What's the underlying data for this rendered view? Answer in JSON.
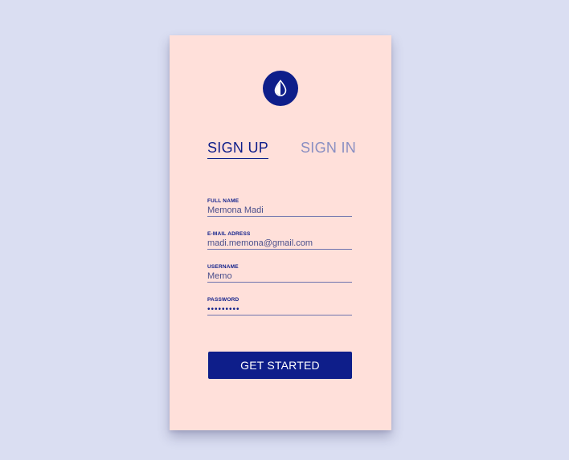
{
  "colors": {
    "background": "#DADEF2",
    "card": "#FFE0DA",
    "accent": "#0E1E8A",
    "inactive_tab": "#8A8FC2",
    "input_text": "#4A4F8C"
  },
  "logo": {
    "icon": "drop-icon"
  },
  "tabs": [
    {
      "label": "SIGN UP",
      "active": true
    },
    {
      "label": "SIGN IN",
      "active": false
    }
  ],
  "form": {
    "full_name": {
      "label": "FULL NAME",
      "value": "Memona Madi"
    },
    "email": {
      "label": "E-MAIL ADRESS",
      "value": "madi.memona@gmail.com"
    },
    "username": {
      "label": "USERNAME",
      "value": "Memo"
    },
    "password": {
      "label": "PASSWORD",
      "value": "•••••••••"
    }
  },
  "cta": {
    "label": "GET STARTED"
  }
}
